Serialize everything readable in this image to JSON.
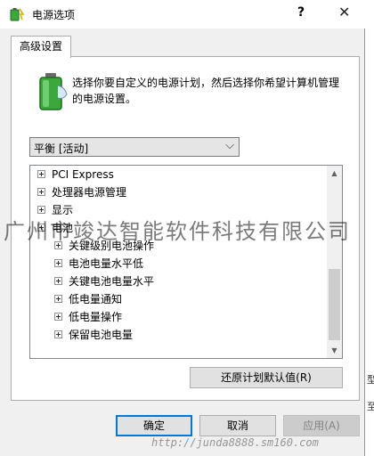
{
  "window": {
    "title": "电源选项",
    "help_glyph": "?",
    "close_glyph": "✕",
    "icon": "power-options-icon"
  },
  "tabs": [
    {
      "label": "高级设置",
      "selected": true
    }
  ],
  "description": "选择你要自定义的电源计划，然后选择你希望计算机管理的电源设置。",
  "plan_select": {
    "value": "平衡 [活动]"
  },
  "tree": {
    "items": [
      {
        "label": "PCI Express",
        "level": 0
      },
      {
        "label": "处理器电源管理",
        "level": 0
      },
      {
        "label": "显示",
        "level": 0
      },
      {
        "label": "电池",
        "level": 0,
        "expanded": true
      },
      {
        "label": "关键级别电池操作",
        "level": 1
      },
      {
        "label": "电池电量水平低",
        "level": 1
      },
      {
        "label": "关键电池电量水平",
        "level": 1
      },
      {
        "label": "低电量通知",
        "level": 1
      },
      {
        "label": "低电量操作",
        "level": 1
      },
      {
        "label": "保留电池电量",
        "level": 1
      }
    ]
  },
  "buttons": {
    "restore": "还原计划默认值(R)",
    "ok": "确定",
    "cancel": "取消",
    "apply": "应用(A)"
  },
  "edge_fragments": [
    "型",
    "至"
  ],
  "watermark": {
    "text": "广州市竣达智能软件科技有限公司",
    "url": "http://junda8888.sm160.com"
  },
  "colors": {
    "accent": "#0078d7",
    "battery_green": "#3aa83a"
  }
}
